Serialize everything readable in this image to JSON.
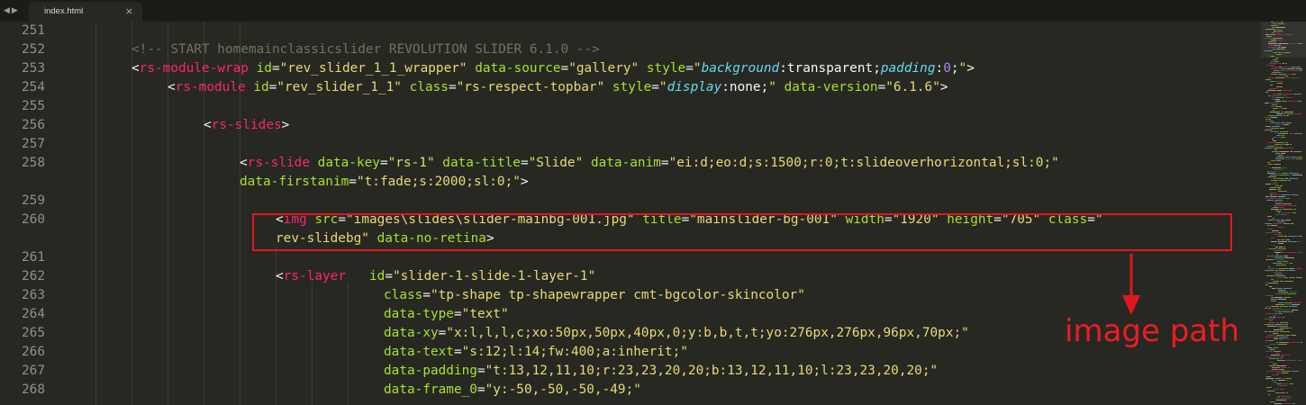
{
  "tab": {
    "title": "index.html",
    "close": "×"
  },
  "nav": {
    "back": "◀",
    "forward": "▶"
  },
  "annotation": {
    "label": "image path",
    "color": "#ed1c24"
  },
  "colors": {
    "background": "#272822",
    "tag": "#f92672",
    "attr": "#a6e22e",
    "string": "#e6db74",
    "comment": "#75715e",
    "css_property": "#66d9ef",
    "number": "#ae81ff"
  },
  "lines": [
    {
      "num": "251",
      "tokens": []
    },
    {
      "num": "252",
      "tokens": [
        [
          "c",
          "<!-- START homemainclassicslider REVOLUTION SLIDER 6.1.0 -->"
        ]
      ]
    },
    {
      "num": "253",
      "tokens": [
        [
          "p",
          "<"
        ],
        [
          "t",
          "rs-module-wrap"
        ],
        [
          "p",
          " "
        ],
        [
          "a",
          "id"
        ],
        [
          "p",
          "="
        ],
        [
          "s",
          "\"rev_slider_1_1_wrapper\""
        ],
        [
          "p",
          " "
        ],
        [
          "a",
          "data-source"
        ],
        [
          "p",
          "="
        ],
        [
          "s",
          "\"gallery\""
        ],
        [
          "p",
          " "
        ],
        [
          "a",
          "style"
        ],
        [
          "p",
          "="
        ],
        [
          "s",
          "\""
        ],
        [
          "k",
          "background"
        ],
        [
          "p",
          ":"
        ],
        [
          "v",
          "transparent"
        ],
        [
          "p",
          ";"
        ],
        [
          "k",
          "padding"
        ],
        [
          "p",
          ":"
        ],
        [
          "n",
          "0"
        ],
        [
          "p",
          ";"
        ],
        [
          "s",
          "\""
        ],
        [
          "p",
          ">"
        ]
      ]
    },
    {
      "num": "254",
      "tokens": [
        [
          "p",
          "<"
        ],
        [
          "t",
          "rs-module"
        ],
        [
          "p",
          " "
        ],
        [
          "a",
          "id"
        ],
        [
          "p",
          "="
        ],
        [
          "s",
          "\"rev_slider_1_1\""
        ],
        [
          "p",
          " "
        ],
        [
          "a",
          "class"
        ],
        [
          "p",
          "="
        ],
        [
          "s",
          "\"rs-respect-topbar\""
        ],
        [
          "p",
          " "
        ],
        [
          "a",
          "style"
        ],
        [
          "p",
          "="
        ],
        [
          "s",
          "\""
        ],
        [
          "k",
          "display"
        ],
        [
          "p",
          ":"
        ],
        [
          "v",
          "none"
        ],
        [
          "p",
          ";"
        ],
        [
          "s",
          "\""
        ],
        [
          "p",
          " "
        ],
        [
          "a",
          "data-version"
        ],
        [
          "p",
          "="
        ],
        [
          "s",
          "\"6.1.6\""
        ],
        [
          "p",
          ">"
        ]
      ]
    },
    {
      "num": "255",
      "tokens": []
    },
    {
      "num": "256",
      "tokens": [
        [
          "p",
          "<"
        ],
        [
          "t",
          "rs-slides"
        ],
        [
          "p",
          ">"
        ]
      ]
    },
    {
      "num": "257",
      "tokens": []
    },
    {
      "num": "258",
      "tokens": [
        [
          "p",
          "<"
        ],
        [
          "t",
          "rs-slide"
        ],
        [
          "p",
          " "
        ],
        [
          "a",
          "data-key"
        ],
        [
          "p",
          "="
        ],
        [
          "s",
          "\"rs-1\""
        ],
        [
          "p",
          " "
        ],
        [
          "a",
          "data-title"
        ],
        [
          "p",
          "="
        ],
        [
          "s",
          "\"Slide\""
        ],
        [
          "p",
          " "
        ],
        [
          "a",
          "data-anim"
        ],
        [
          "p",
          "="
        ],
        [
          "s",
          "\"ei:d;eo:d;s:1500;r:0;t:slideoverhorizontal;sl:0;\""
        ]
      ]
    },
    {
      "num": "",
      "tokens": [
        [
          "a",
          "data-firstanim"
        ],
        [
          "p",
          "="
        ],
        [
          "s",
          "\"t:fade;s:2000;sl:0;\""
        ],
        [
          "p",
          ">"
        ]
      ]
    },
    {
      "num": "259",
      "tokens": []
    },
    {
      "num": "260",
      "tokens": [
        [
          "p",
          "<"
        ],
        [
          "t",
          "img"
        ],
        [
          "p",
          " "
        ],
        [
          "a",
          "src"
        ],
        [
          "p",
          "="
        ],
        [
          "s",
          "\"images\\slides\\slider-mainbg-001.jpg\""
        ],
        [
          "p",
          " "
        ],
        [
          "a",
          "title"
        ],
        [
          "p",
          "="
        ],
        [
          "s",
          "\"mainslider-bg-001\""
        ],
        [
          "p",
          " "
        ],
        [
          "a",
          "width"
        ],
        [
          "p",
          "="
        ],
        [
          "s",
          "\"1920\""
        ],
        [
          "p",
          " "
        ],
        [
          "a",
          "height"
        ],
        [
          "p",
          "="
        ],
        [
          "s",
          "\"705\""
        ],
        [
          "p",
          " "
        ],
        [
          "a",
          "class"
        ],
        [
          "p",
          "="
        ],
        [
          "s",
          "\""
        ]
      ]
    },
    {
      "num": "",
      "tokens": [
        [
          "s",
          "rev-slidebg\""
        ],
        [
          "p",
          " "
        ],
        [
          "a",
          "data-no-retina"
        ],
        [
          "p",
          ">"
        ]
      ]
    },
    {
      "num": "261",
      "tokens": []
    },
    {
      "num": "262",
      "tokens": [
        [
          "p",
          "<"
        ],
        [
          "t",
          "rs-layer"
        ],
        [
          "p",
          "   "
        ],
        [
          "a",
          "id"
        ],
        [
          "p",
          "="
        ],
        [
          "s",
          "\"slider-1-slide-1-layer-1\""
        ]
      ]
    },
    {
      "num": "263",
      "tokens": [
        [
          "a",
          "class"
        ],
        [
          "p",
          "="
        ],
        [
          "s",
          "\"tp-shape tp-shapewrapper cmt-bgcolor-skincolor\""
        ]
      ]
    },
    {
      "num": "264",
      "tokens": [
        [
          "a",
          "data-type"
        ],
        [
          "p",
          "="
        ],
        [
          "s",
          "\"text\""
        ]
      ]
    },
    {
      "num": "265",
      "tokens": [
        [
          "a",
          "data-xy"
        ],
        [
          "p",
          "="
        ],
        [
          "s",
          "\"x:l,l,l,c;xo:50px,50px,40px,0;y:b,b,t,t;yo:276px,276px,96px,70px;\""
        ]
      ]
    },
    {
      "num": "266",
      "tokens": [
        [
          "a",
          "data-text"
        ],
        [
          "p",
          "="
        ],
        [
          "s",
          "\"s:12;l:14;fw:400;a:inherit;\""
        ]
      ]
    },
    {
      "num": "267",
      "tokens": [
        [
          "a",
          "data-padding"
        ],
        [
          "p",
          "="
        ],
        [
          "s",
          "\"t:13,12,11,10;r:23,23,20,20;b:13,12,11,10;l:23,23,20,20;\""
        ]
      ]
    },
    {
      "num": "268",
      "tokens": [
        [
          "a",
          "data-frame_0"
        ],
        [
          "p",
          "="
        ],
        [
          "s",
          "\"y:-50,-50,-50,-49;\""
        ]
      ]
    }
  ]
}
